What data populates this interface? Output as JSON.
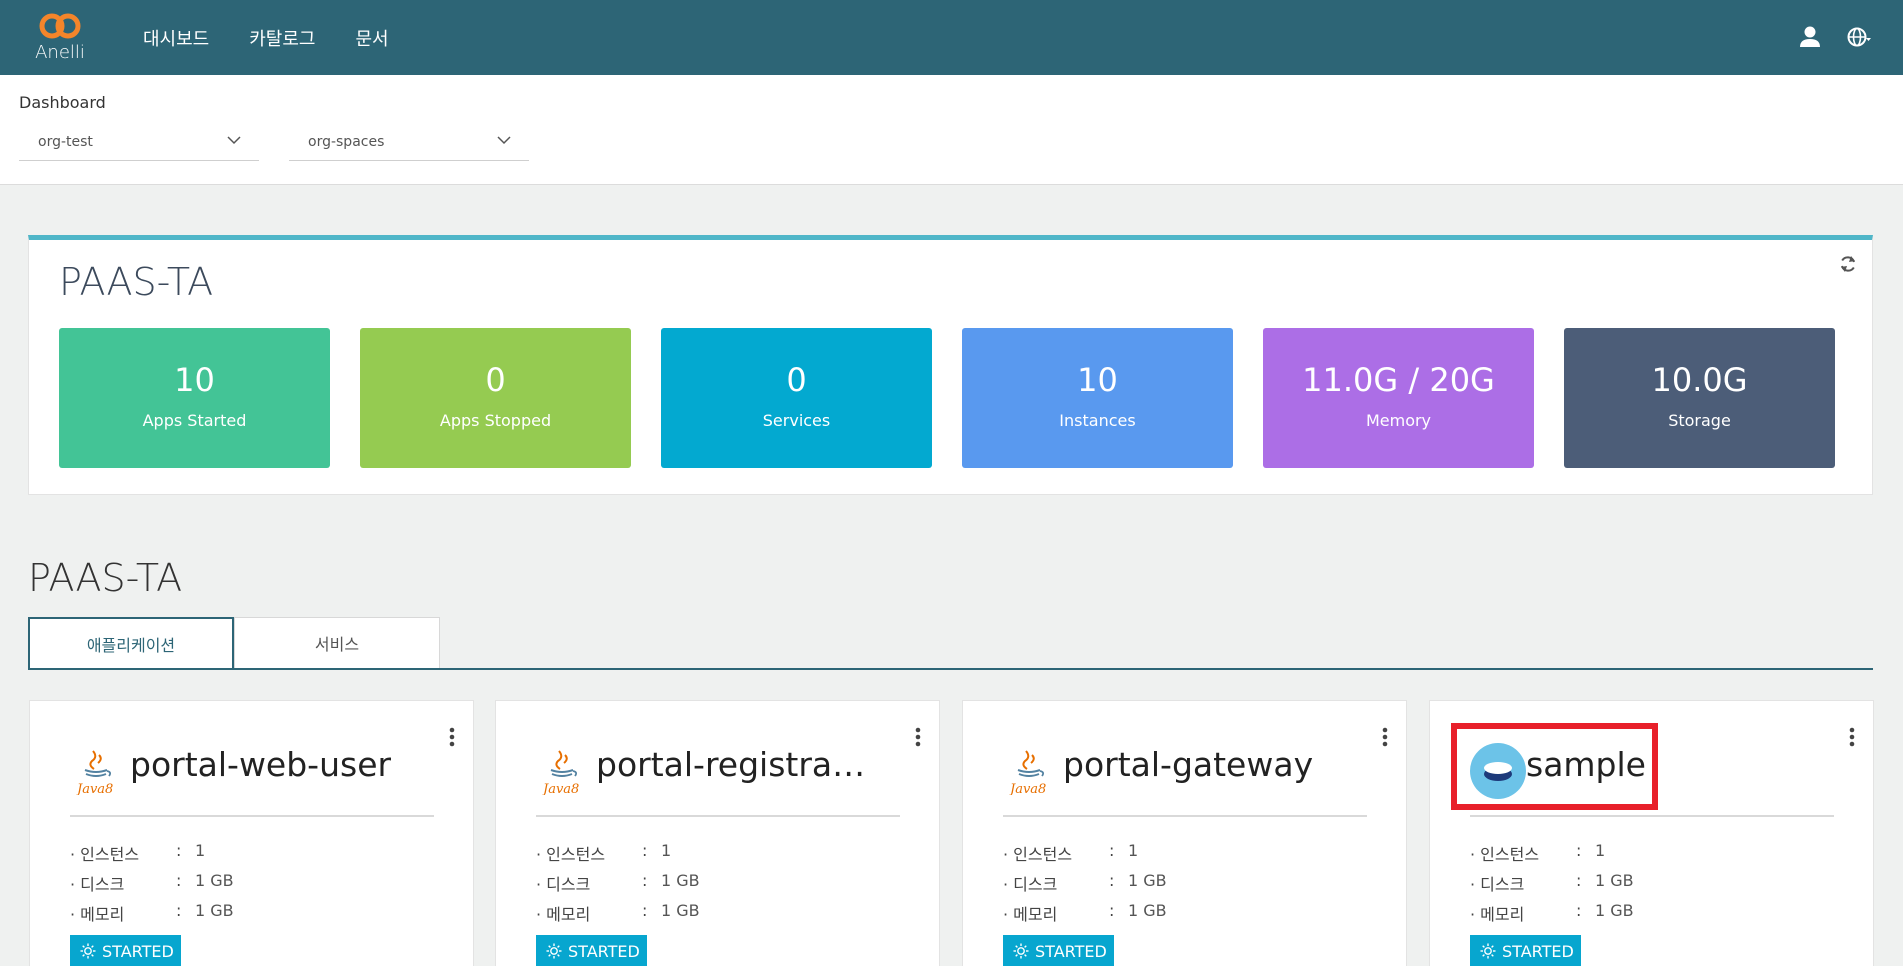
{
  "header": {
    "logo_text": "Anelli",
    "nav": [
      "대시보드",
      "카탈로그",
      "문서"
    ],
    "icons": [
      "user-icon",
      "globe-icon"
    ]
  },
  "subheader": {
    "breadcrumb": "Dashboard",
    "org_select": "org-test",
    "space_select": "org-spaces"
  },
  "summary": {
    "title": "PAAS-TA",
    "stats": [
      {
        "value": "10",
        "label": "Apps Started",
        "color": "#43c496"
      },
      {
        "value": "0",
        "label": "Apps Stopped",
        "color": "#95cb51"
      },
      {
        "value": "0",
        "label": "Services",
        "color": "#03a9d0"
      },
      {
        "value": "10",
        "label": "Instances",
        "color": "#5999ef"
      },
      {
        "value": "11.0G / 20G",
        "label": "Memory",
        "color": "#ac6ee6"
      },
      {
        "value": "10.0G",
        "label": "Storage",
        "color": "#4c5d78"
      }
    ]
  },
  "section": {
    "title": "PAAS-TA",
    "tabs": [
      "애플리케이션",
      "서비스"
    ]
  },
  "apps": [
    {
      "name": "portal-web-user",
      "icon": "java8-icon",
      "instances": "1",
      "disk": "1 GB",
      "memory": "1 GB",
      "status": "STARTED"
    },
    {
      "name": "portal-registrati…",
      "icon": "java8-icon",
      "instances": "1",
      "disk": "1 GB",
      "memory": "1 GB",
      "status": "STARTED"
    },
    {
      "name": "portal-gateway",
      "icon": "java8-icon",
      "instances": "1",
      "disk": "1 GB",
      "memory": "1 GB",
      "status": "STARTED"
    },
    {
      "name": "sample",
      "icon": "app-bubble-icon",
      "instances": "1",
      "disk": "1 GB",
      "memory": "1 GB",
      "status": "STARTED"
    }
  ],
  "labels": {
    "instances": "· 인스턴스",
    "disk": "· 디스크",
    "memory": "· 메모리",
    "colon": ":"
  },
  "java_badge": "Java8"
}
